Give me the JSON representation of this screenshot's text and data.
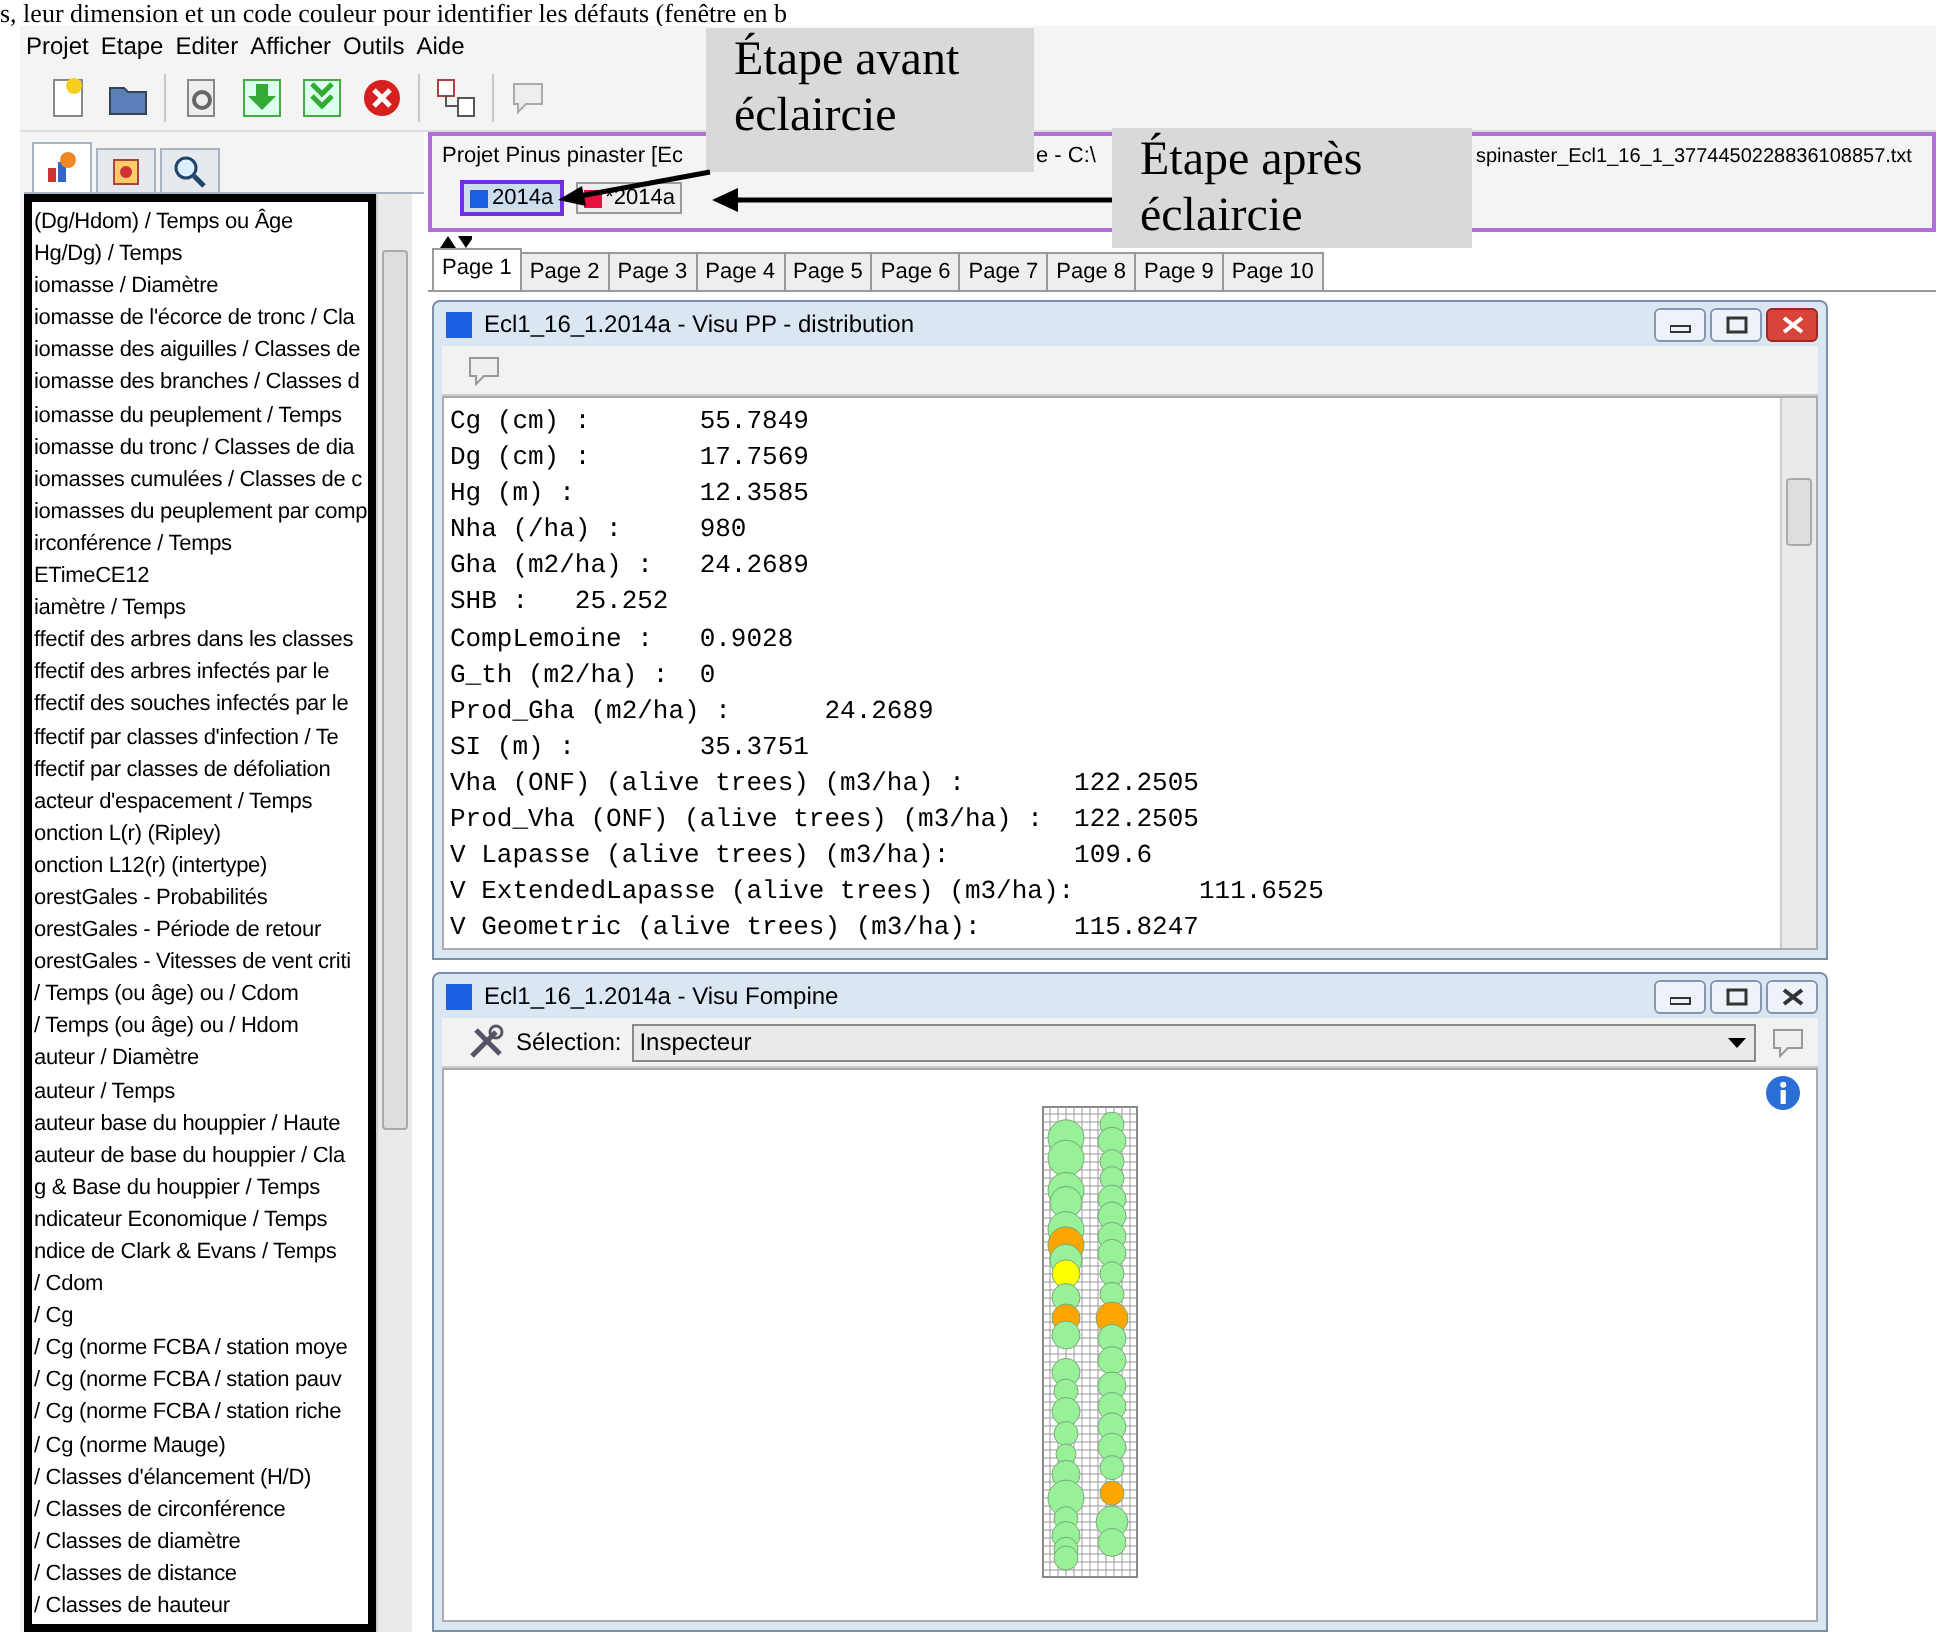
{
  "document_text": "s, leur dimension et un code couleur pour identifier les défauts (fenêtre en b",
  "menu": [
    "Projet",
    "Etape",
    "Editer",
    "Afficher",
    "Outils",
    "Aide"
  ],
  "left_tabs": [
    {
      "selected": true
    },
    {
      "selected": false
    },
    {
      "selected": false
    }
  ],
  "chart_list": [
    "(Dg/Hdom) / Temps ou Âge",
    "Hg/Dg) / Temps",
    "iomasse / Diamètre",
    "iomasse de l'écorce de tronc / Cla",
    "iomasse des aiguilles / Classes de",
    "iomasse des branches / Classes d",
    "iomasse du peuplement  / Temps",
    "iomasse du tronc / Classes de dia",
    "iomasses cumulées / Classes de c",
    "iomasses du peuplement par comp",
    "irconférence / Temps",
    "ETimeCE12",
    "iamètre / Temps",
    "ffectif des arbres dans les classes",
    "ffectif des arbres infectés par le",
    "ffectif des souches infectés par le",
    "ffectif par classes d'infection  / Te",
    "ffectif par classes de défoliation",
    "acteur d'espacement / Temps",
    "onction L(r) (Ripley)",
    "onction L12(r) (intertype)",
    "orestGales - Probabilités",
    "orestGales - Période de retour",
    "orestGales - Vitesses de vent criti",
    "/ Temps (ou âge) ou / Cdom",
    "/ Temps (ou âge) ou / Hdom",
    "auteur / Diamètre",
    "auteur / Temps",
    "auteur base du houppier / Haute",
    "auteur de base du houppier / Cla",
    "g & Base du houppier / Temps",
    "ndicateur Economique / Temps",
    "ndice de Clark & Evans / Temps",
    "/ Cdom",
    "/ Cg",
    "/ Cg (norme FCBA / station moye",
    "/ Cg (norme FCBA / station pauv",
    "/ Cg (norme FCBA / station riche",
    "/ Cg (norme Mauge)",
    "/ Classes d'élancement (H/D)",
    "/ Classes de circonférence",
    "/ Classes de diamètre",
    "/ Classes de distance",
    "/ Classes de hauteur"
  ],
  "project_title": [
    "Projet Pinus pinaster  [Ec",
    "e - C:\\",
    "spinaster_Ecl1_16_1_3774450228836108857.txt"
  ],
  "steps": [
    {
      "label": "2014a",
      "color": "#1a5fe0",
      "selected": true
    },
    {
      "label": "*2014a",
      "color": "#e8103c",
      "selected": false
    }
  ],
  "tabs": [
    {
      "label": "Page 1",
      "selected": true
    },
    {
      "label": "Page 2",
      "selected": false
    },
    {
      "label": "Page 3",
      "selected": false
    },
    {
      "label": "Page 4",
      "selected": false
    },
    {
      "label": "Page 5",
      "selected": false
    },
    {
      "label": "Page 6",
      "selected": false
    },
    {
      "label": "Page 7",
      "selected": false
    },
    {
      "label": "Page 8",
      "selected": false
    },
    {
      "label": "Page 9",
      "selected": false
    },
    {
      "label": "Page 10",
      "selected": false
    }
  ],
  "windows": [
    {
      "kind": "text",
      "title": "Ecl1_16_1.2014a - Visu PP - distribution",
      "active": true,
      "lines": [
        "Cg (cm) :       55.7849",
        "Dg (cm) :       17.7569",
        "Hg (m) :        12.3585",
        "Nha (/ha) :     980",
        "Gha (m2/ha) :   24.2689",
        "SHB :   25.252",
        "CompLemoine :   0.9028",
        "G_th (m2/ha) :  0",
        "Prod_Gha (m2/ha) :      24.2689",
        "SI (m) :        35.3751",
        "Vha (ONF) (alive trees) (m3/ha) :       122.2505",
        "Prod_Vha (ONF) (alive trees) (m3/ha) :  122.2505",
        "V Lapasse (alive trees) (m3/ha):        109.6",
        "V ExtendedLapasse (alive trees) (m3/ha):        111.6525",
        "V Geometric (alive trees) (m3/ha):      115.8247"
      ]
    },
    {
      "kind": "map",
      "title": "Ecl1_16_1.2014a - Visu Fompine",
      "active": false,
      "selection_label": "Sélection:",
      "selection_value": "Inspecteur"
    }
  ],
  "callouts": [
    [
      "Étape avant",
      "éclaircie"
    ],
    [
      "Étape après",
      "éclaircie"
    ]
  ]
}
